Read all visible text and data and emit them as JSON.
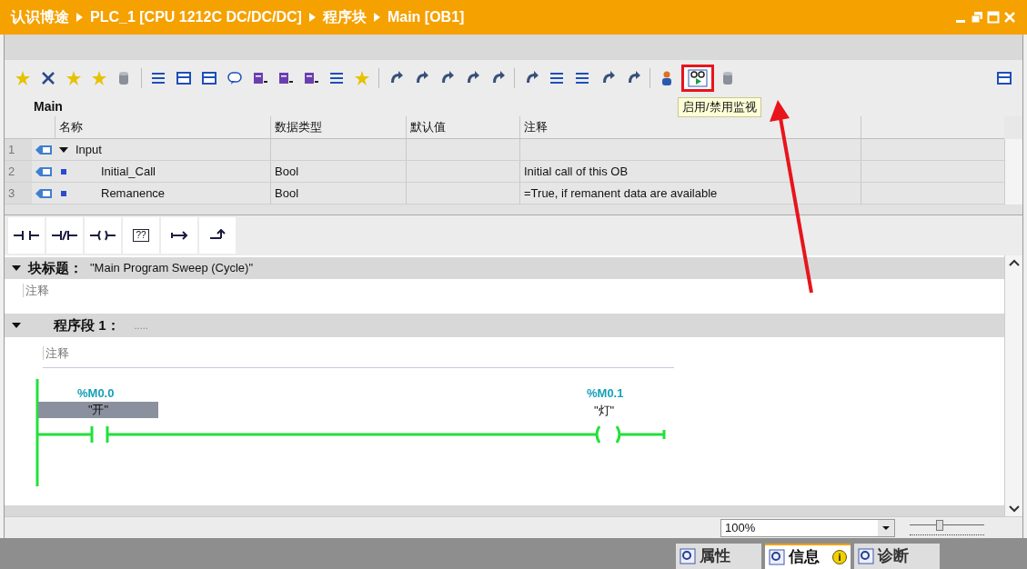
{
  "breadcrumb": [
    "认识博途",
    "PLC_1 [CPU 1212C DC/DC/DC]",
    "程序块",
    "Main [OB1]"
  ],
  "monitor_button": {
    "selected": true,
    "tooltip": "启用/禁用监视"
  },
  "interface": {
    "title": "Main",
    "columns": [
      "名称",
      "数据类型",
      "默认值",
      "注释"
    ],
    "rows": [
      {
        "index": "1",
        "kind": "section",
        "name": "Input",
        "expanded": true
      },
      {
        "index": "2",
        "kind": "tag",
        "name": "Initial_Call",
        "type": "Bool",
        "comment": "Initial call of this OB"
      },
      {
        "index": "3",
        "kind": "tag",
        "name": "Remanence",
        "type": "Bool",
        "comment": "=True, if remanent data are available"
      }
    ]
  },
  "palette": {
    "box_label": "??"
  },
  "block": {
    "label": "块标题：",
    "title": "\"Main Program Sweep (Cycle)\"",
    "comment": "注释",
    "expanded": true
  },
  "networks": [
    {
      "label": "程序段 1：",
      "title": ".....",
      "comment": "注释",
      "expanded": true,
      "powered": true,
      "contact": {
        "address": "%M0.0",
        "tag": "\"开\"",
        "selected": true
      },
      "coil": {
        "address": "%M0.1",
        "tag": "\"灯\""
      }
    }
  ],
  "zoom": {
    "value": "100%",
    "level": 0.4
  },
  "tabs": [
    {
      "label": "属性",
      "selected": false
    },
    {
      "label": "信息",
      "selected": true,
      "badge": "i"
    },
    {
      "label": "诊断",
      "selected": false
    }
  ]
}
